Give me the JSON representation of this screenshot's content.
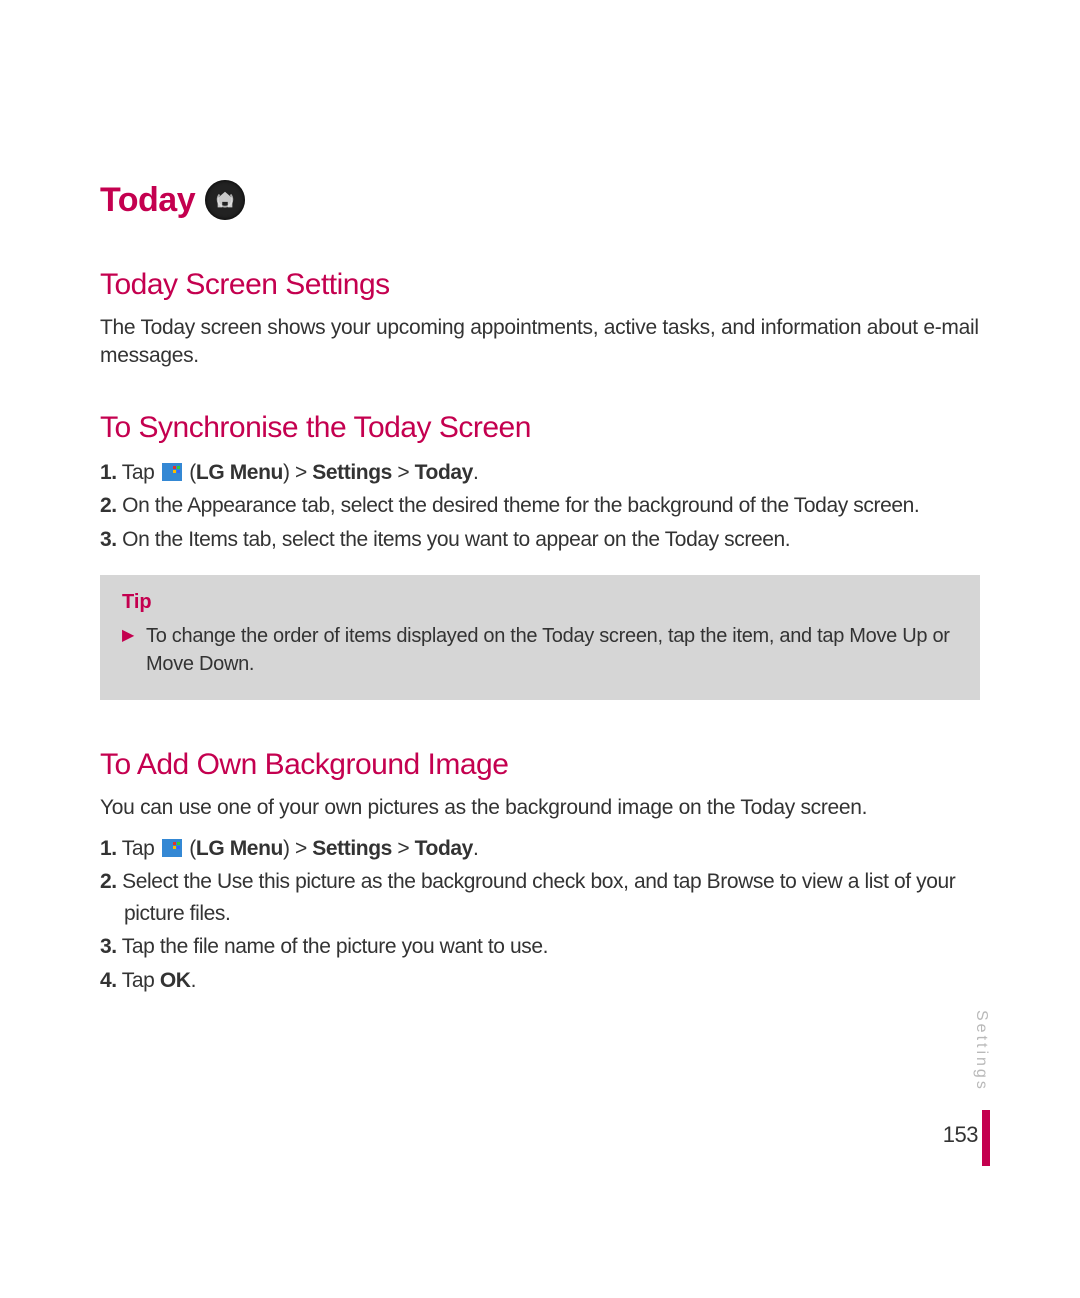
{
  "title": "Today",
  "iconName": "today-icon",
  "sections": {
    "todayScreen": {
      "heading": "Today Screen Settings",
      "intro": "The Today screen shows your upcoming appointments, active tasks, and information about e-mail messages."
    },
    "sync": {
      "heading": "To Synchronise the Today Screen",
      "steps": {
        "s1": {
          "num": "1.",
          "pre": "Tap ",
          "lgMenu": "LG Menu",
          "sep1": ") > ",
          "settings": "Settings",
          "sep2": " > ",
          "today": "Today",
          "end": "."
        },
        "s2": {
          "num": "2.",
          "text": " On the Appearance tab, select the desired theme for the background of the Today screen."
        },
        "s3": {
          "num": "3.",
          "text": " On the Items tab, select the items you want to appear on the Today screen."
        }
      }
    },
    "tip": {
      "title": "Tip",
      "text": "To change the order of items displayed on the Today screen, tap the item, and tap Move Up or Move Down."
    },
    "addBg": {
      "heading": "To Add Own Background Image",
      "intro": "You can use one of your own pictures as the background image on the Today screen.",
      "steps": {
        "s1": {
          "num": "1.",
          "pre": "Tap ",
          "lgMenu": "LG Menu",
          "sep1": ") > ",
          "settings": "Settings",
          "sep2": " > ",
          "today": "Today",
          "end": "."
        },
        "s2": {
          "num": "2.",
          "text": " Select the Use this picture as the background check box, and tap Browse to view a list of your picture files."
        },
        "s3": {
          "num": "3.",
          "text": " Tap the file name of the picture you want to use."
        },
        "s4": {
          "num": "4.",
          "pre": " Tap ",
          "ok": "OK",
          "end": "."
        }
      }
    }
  },
  "sideTab": "Settings",
  "pageNumber": "153"
}
